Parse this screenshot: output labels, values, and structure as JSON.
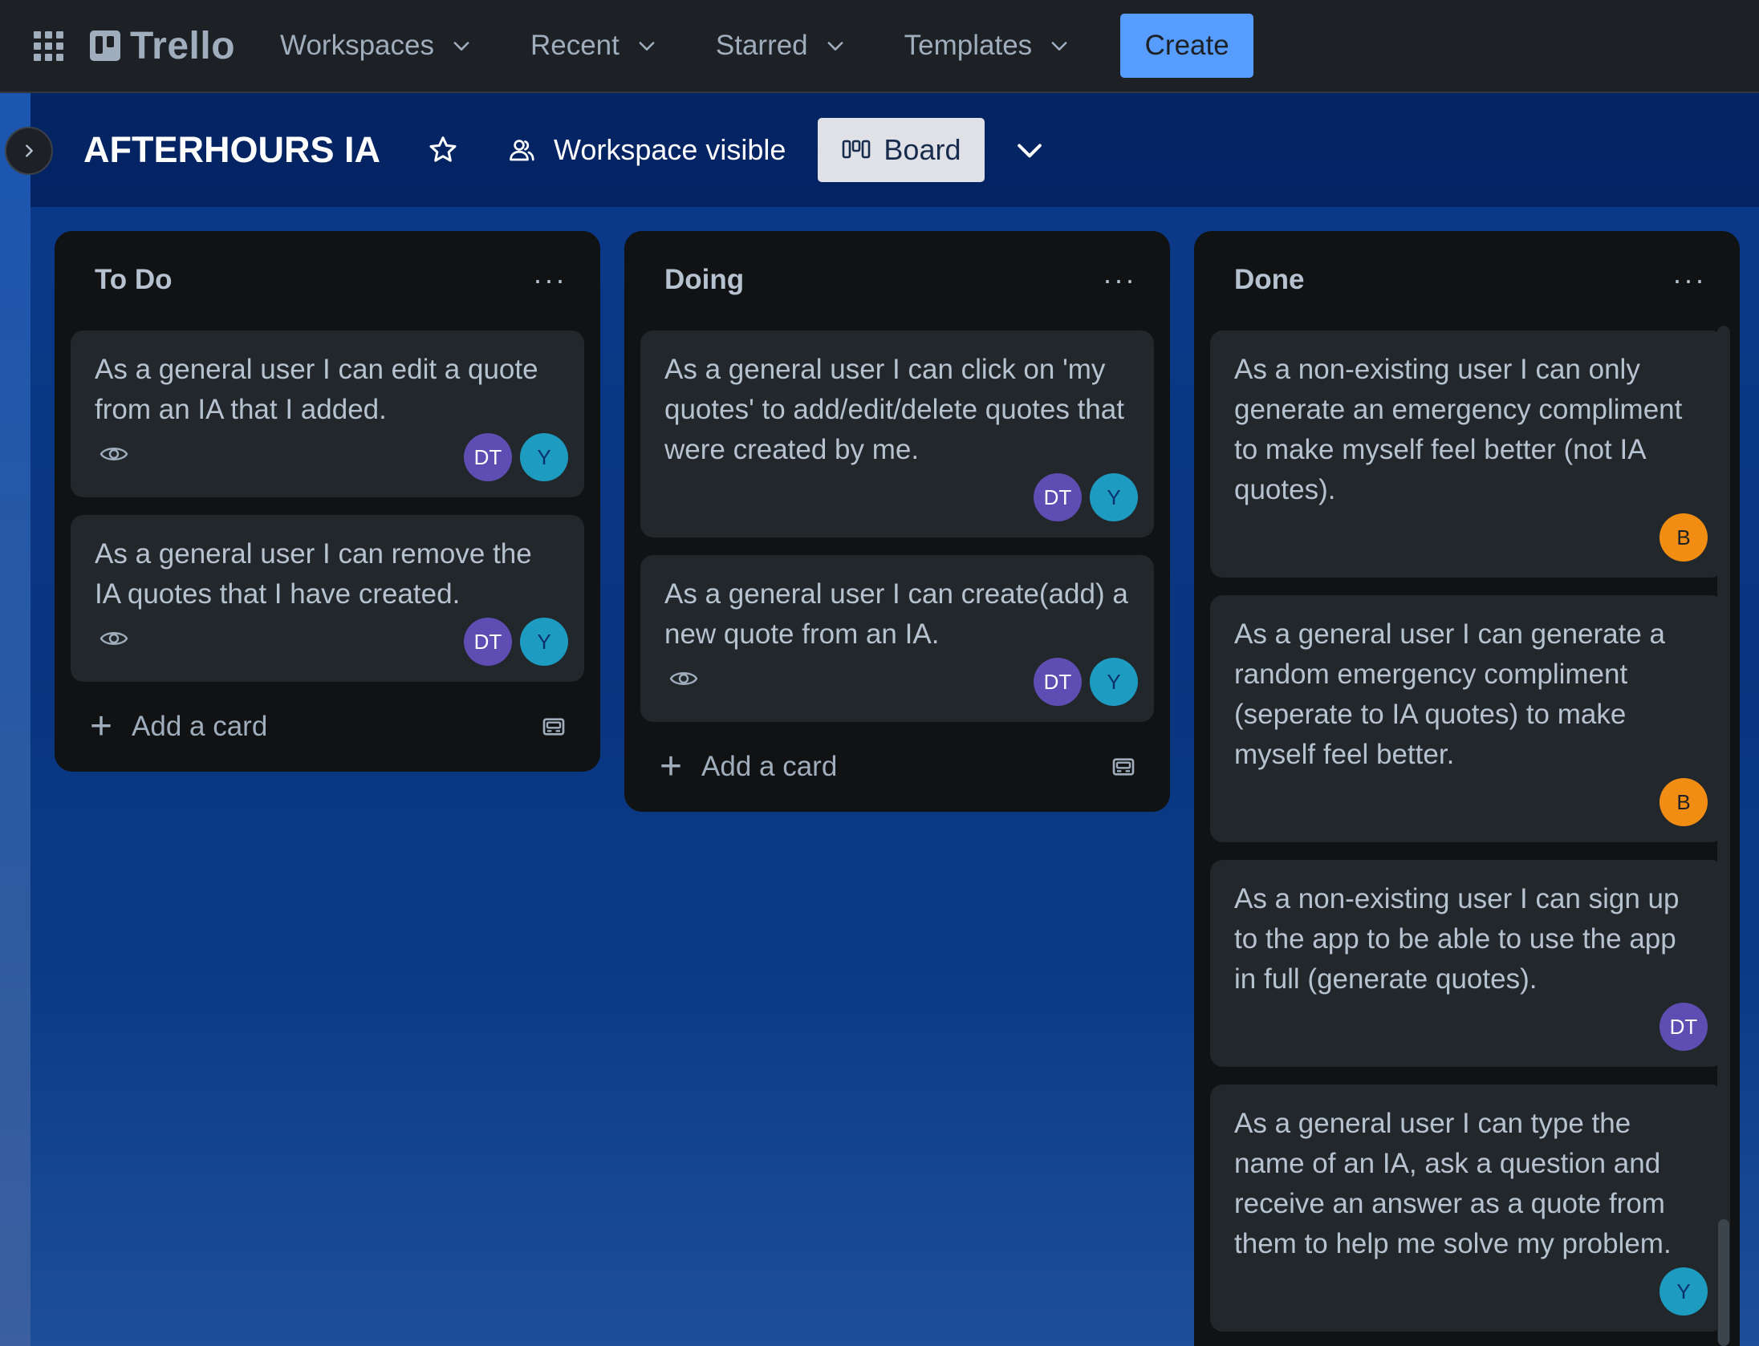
{
  "topnav": {
    "logo_text": "Trello",
    "menus": [
      "Workspaces",
      "Recent",
      "Starred",
      "Templates"
    ],
    "create_label": "Create"
  },
  "board": {
    "title": "AFTERHOURS IA",
    "visibility_label": "Workspace visible",
    "view_label": "Board"
  },
  "lists": [
    {
      "title": "To Do",
      "menu": "···",
      "cards": [
        {
          "text": "As a general user I can edit a quote from an IA that I added.",
          "members": [
            "DT",
            "Y"
          ]
        },
        {
          "text": "As a general user I can remove the IA quotes that I have created.",
          "members": [
            "DT",
            "Y"
          ]
        }
      ],
      "add_label": "Add a card"
    },
    {
      "title": "Doing",
      "menu": "···",
      "cards": [
        {
          "text": "As a general user I can click on 'my quotes' to add/edit/delete quotes that were created by me.",
          "members": [
            "DT",
            "Y"
          ]
        },
        {
          "text": "As a general user I can create(add) a new quote from an IA.",
          "members": [
            "DT",
            "Y"
          ]
        }
      ],
      "add_label": "Add a card"
    },
    {
      "title": "Done",
      "menu": "···",
      "cards": [
        {
          "text": "As a non-existing user I can only generate an emergency compliment to make myself feel better (not IA quotes).",
          "members": [
            "B"
          ]
        },
        {
          "text": "As a general user I can generate a random emergency compliment (seperate to IA quotes) to make myself feel better.",
          "members": [
            "B"
          ]
        },
        {
          "text": "As a non-existing user I can sign up to the app to be able to use the app in full (generate quotes).",
          "members": [
            "DT"
          ]
        },
        {
          "text": "As a general user I can type the name of an IA, ask a question and receive an answer as a quote from them to help me solve my problem.",
          "members": [
            "Y"
          ]
        }
      ]
    }
  ],
  "icons": [
    "apps-grid-icon",
    "trello-logo-icon",
    "chevron-down-icon",
    "chevron-right-icon",
    "star-icon",
    "people-icon",
    "board-columns-icon",
    "eye-icon",
    "plus-icon",
    "card-template-icon"
  ],
  "colors": {
    "create_button": "#579dff",
    "board_background": "#0b3a8a",
    "avatar_dt": "#5e4db2",
    "avatar_y": "#1d9bc0",
    "avatar_b": "#f18d13"
  }
}
